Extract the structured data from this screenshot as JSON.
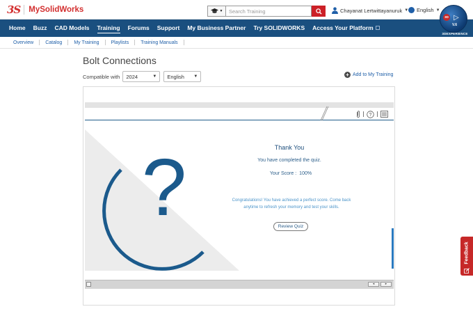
{
  "header": {
    "logo_text": "3S",
    "site_name": "MySolidWorks",
    "search": {
      "scope_icon": "graduation-cap-icon",
      "placeholder": "Search Training",
      "value": ""
    },
    "user_name": "Chayanat Lertwittayanuruk",
    "language": "English",
    "compass": {
      "badge": "3D",
      "version": "V.6",
      "label": "3DEXPERIENCE"
    }
  },
  "nav": {
    "items": [
      {
        "label": "Home"
      },
      {
        "label": "Buzz"
      },
      {
        "label": "CAD Models"
      },
      {
        "label": "Training"
      },
      {
        "label": "Forums"
      },
      {
        "label": "Support"
      },
      {
        "label": "My Business Partner"
      },
      {
        "label": "Try SOLIDWORKS"
      },
      {
        "label": "Access Your Platform"
      }
    ],
    "active": "Training"
  },
  "subnav": {
    "items": [
      {
        "label": "Overview"
      },
      {
        "label": "Catalog"
      },
      {
        "label": "My Training"
      },
      {
        "label": "Playlists"
      },
      {
        "label": "Training Manuals"
      }
    ]
  },
  "page": {
    "title": "Bolt Connections",
    "compatible_label": "Compatible with",
    "version_select": "2024",
    "language_select": "English",
    "add_training": "Add to My Training"
  },
  "quiz": {
    "title": "Thank You",
    "completed_text": "You have completed the quiz.",
    "score_label": "Your Score :",
    "score_value": "100%",
    "congrats_line1": "Congratulations! You have achieved a perfect score. Come back",
    "congrats_line2": "anytime to refresh your memory and test your skills.",
    "review_button": "Review Quiz",
    "question_mark": "?"
  },
  "feedback": {
    "label": "Feedback"
  },
  "colors": {
    "brand_red": "#d32f2f",
    "nav_blue": "#1a4f7f",
    "link_blue": "#1f5fa8",
    "quiz_blue": "#1e4f7d"
  }
}
